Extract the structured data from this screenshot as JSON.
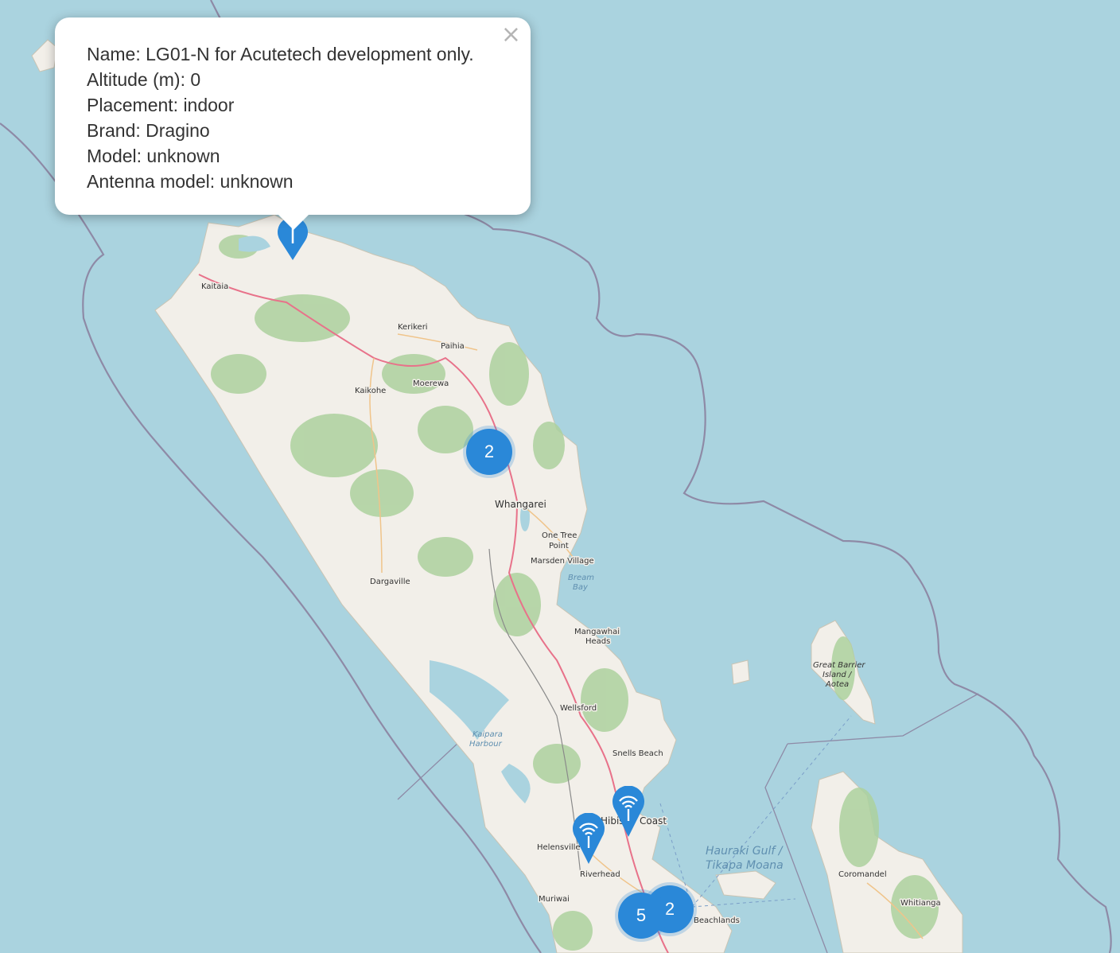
{
  "popup": {
    "lines": [
      "Name: LG01-N for Acutetech development only.",
      "Altitude (m): 0",
      "Placement: indoor",
      "Brand: Dragino",
      "Model: unknown",
      "Antenna model: unknown"
    ],
    "close_icon": "×"
  },
  "clusters": [
    {
      "count": "2"
    },
    {
      "count": "5"
    },
    {
      "count": "2"
    }
  ],
  "marker_icon": "gateway-antenna-icon",
  "places": {
    "kaitaia": "Kaitaia",
    "kerikeri": "Kerikeri",
    "paihia": "Paihia",
    "kaikohe": "Kaikohe",
    "moerewa": "Moerewa",
    "whangarei": "Whangarei",
    "one_tree_1": "One Tree",
    "one_tree_2": "Point",
    "marsden": "Marsden Village",
    "dargaville": "Dargaville",
    "mangawhai_1": "Mangawhai",
    "mangawhai_2": "Heads",
    "wellsford": "Wellsford",
    "snells": "Snells Beach",
    "hibiscus_1": "Hibis",
    "hibiscus_2": "Coast",
    "helensville": "Helensville",
    "riverhead": "Riverhead",
    "muriwai": "Muriwai",
    "beachlands": "Beachlands",
    "coromandel": "Coromandel",
    "whitianga": "Whitianga"
  },
  "water": {
    "bream_1": "Bream",
    "bream_2": "Bay",
    "kaipara_1": "Kaipara",
    "kaipara_2": "Harbour",
    "hauraki_1": "Hauraki Gulf /",
    "hauraki_2": "Tikapa Moana",
    "gbi_1": "Great Barrier",
    "gbi_2": "Island /",
    "gbi_3": "Aotea"
  },
  "colors": {
    "sea": "#aad3df",
    "land": "#f2efe9",
    "forest": "#add19e",
    "marker": "#2a88d8",
    "boundary": "#8e8aa6"
  }
}
